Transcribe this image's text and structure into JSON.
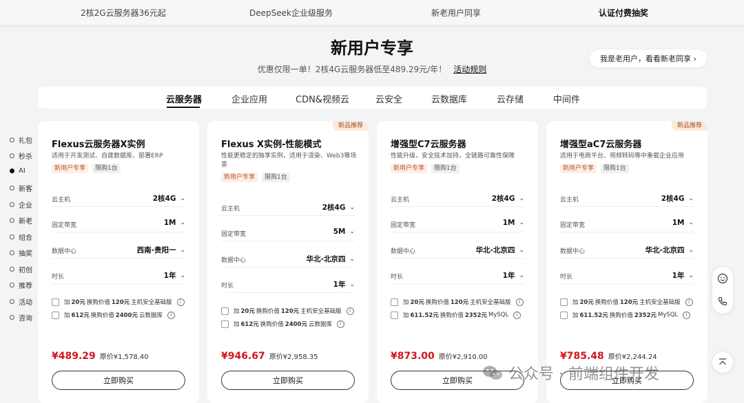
{
  "topnav": {
    "items": [
      "2核2G云服务器36元起",
      "DeepSeek企业级服务",
      "新老用户同享",
      "认证付费抽奖"
    ]
  },
  "hero": {
    "title": "新用户专享",
    "subtitle": "优惠仅限一单！2核4G云服务器低至489.29元/年！",
    "rules_link": "活动规则",
    "old_user_button": "我是老用户，看看新老同享 ›"
  },
  "categories": [
    "云服务器",
    "企业应用",
    "CDN&视频云",
    "云安全",
    "云数据库",
    "云存储",
    "中间件"
  ],
  "sidenav": [
    "礼包",
    "秒杀",
    "AI",
    "新客",
    "企业",
    "新老",
    "组合",
    "抽奖",
    "初创",
    "推荐",
    "活动",
    "咨询"
  ],
  "spec_labels": {
    "host": "云主机",
    "bandwidth": "固定带宽",
    "datacenter": "数据中心",
    "duration": "时长"
  },
  "addon_text": {
    "prefix": "加",
    "exchange": "换购价值",
    "original_label": "原价",
    "buy_button": "立即购买"
  },
  "cards": [
    {
      "badge": "",
      "title": "Flexus云服务器X实例",
      "desc": "适用于开发测试、自建数据库、部署ERP",
      "tags": [
        "新用户专享",
        "限购1台"
      ],
      "host": "2核4G",
      "bandwidth": "1M",
      "datacenter": "西南-贵阳一",
      "duration": "1年",
      "addons": [
        {
          "add": "20元",
          "value": "120元",
          "item": "主机安全基础版"
        },
        {
          "add": "612元",
          "value": "2400元",
          "item": "云数据库"
        }
      ],
      "price": "¥489.29",
      "original": "¥1,578.40"
    },
    {
      "badge": "新品推荐",
      "title": "Flexus X实例-性能模式",
      "desc": "性能更稳定的独享实例，适用于渲染、Web3等场景",
      "tags": [
        "新用户专享",
        "限购1台"
      ],
      "host": "2核4G",
      "bandwidth": "5M",
      "datacenter": "华北-北京四",
      "duration": "1年",
      "addons": [
        {
          "add": "20元",
          "value": "120元",
          "item": "主机安全基础版"
        },
        {
          "add": "612元",
          "value": "2400元",
          "item": "云数据库"
        }
      ],
      "price": "¥946.67",
      "original": "¥2,958.35"
    },
    {
      "badge": "",
      "title": "增强型C7云服务器",
      "desc": "性能升级，安全技术加持，全链路可靠性保障",
      "tags": [
        "新用户专享",
        "限购1台"
      ],
      "host": "2核4G",
      "bandwidth": "1M",
      "datacenter": "华北-北京四",
      "duration": "1年",
      "addons": [
        {
          "add": "20元",
          "value": "120元",
          "item": "主机安全基础版"
        },
        {
          "add": "611.52元",
          "value": "2352元",
          "item": "MySQL"
        }
      ],
      "price": "¥873.00",
      "original": "¥2,910.00"
    },
    {
      "badge": "新品推荐",
      "title": "增强型aC7云服务器",
      "desc": "适用于电商平台、视频转码等中重载企业应用",
      "tags": [
        "新用户专享",
        "限购1台"
      ],
      "host": "2核4G",
      "bandwidth": "1M",
      "datacenter": "华北-北京四",
      "duration": "1年",
      "addons": [
        {
          "add": "20元",
          "value": "120元",
          "item": "主机安全基础版"
        },
        {
          "add": "611.52元",
          "value": "2352元",
          "item": "MySQL"
        }
      ],
      "price": "¥785.48",
      "original": "¥2,244.24"
    }
  ],
  "watermark": "公众号 · 前端组件开发",
  "colors": {
    "price_red": "#d4161c",
    "tag_orange_bg": "#fdeee6",
    "badge_bg": "#fce9dc"
  },
  "icons": [
    "smile-icon",
    "phone-icon",
    "back-to-top-icon",
    "chevron-down-icon",
    "info-icon"
  ]
}
